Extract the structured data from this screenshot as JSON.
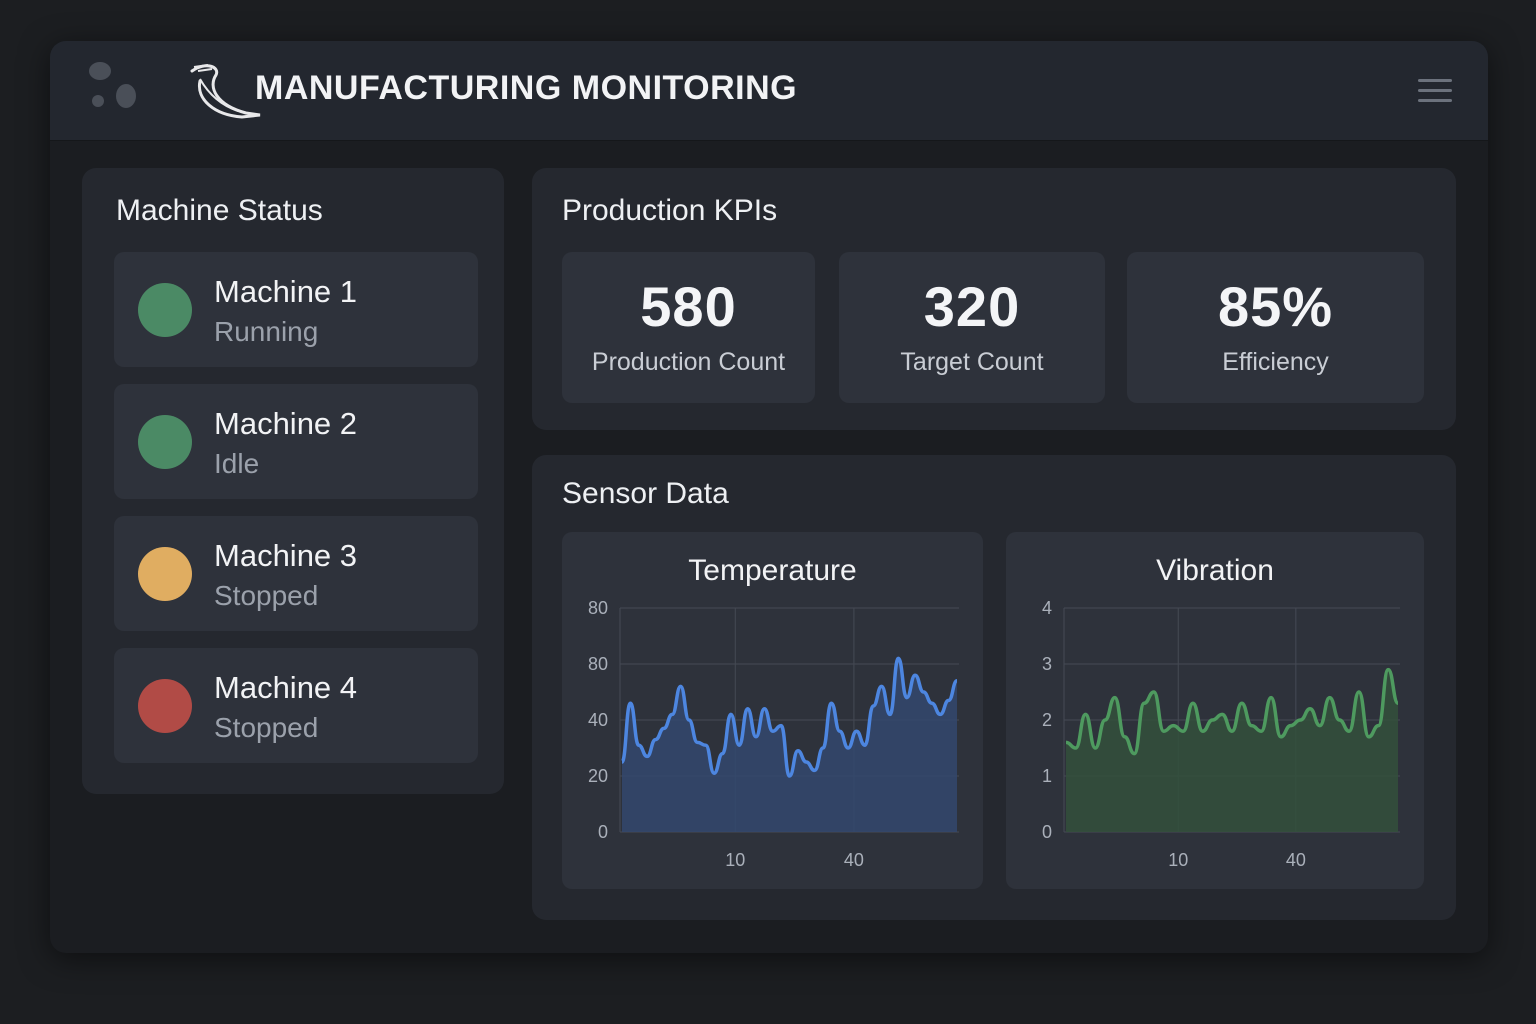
{
  "header": {
    "title": "MANUFACTURING MONITORING",
    "app_icon": "cluster-dots-icon",
    "brand_icon": "horn-logo-icon",
    "menu_icon": "hamburger-menu-icon"
  },
  "machine_status": {
    "title": "Machine Status",
    "machines": [
      {
        "name": "Machine 1",
        "state": "Running",
        "color": "#4b8a65"
      },
      {
        "name": "Machine 2",
        "state": "Idle",
        "color": "#4b8a65"
      },
      {
        "name": "Machine 3",
        "state": "Stopped",
        "color": "#e0ad61"
      },
      {
        "name": "Machine 4",
        "state": "Stopped",
        "color": "#b14b46"
      }
    ]
  },
  "kpis": {
    "title": "Production KPIs",
    "items": [
      {
        "value": "580",
        "label": "Production Count"
      },
      {
        "value": "320",
        "label": "Target Count"
      },
      {
        "value": "85%",
        "label": "Efficiency"
      }
    ]
  },
  "sensor": {
    "title": "Sensor Data",
    "charts": [
      {
        "title": "Temperature",
        "color": "#4d86e0",
        "fill": "#33486e",
        "y_ticks": [
          "0",
          "20",
          "40",
          "80",
          "80"
        ],
        "x_ticks": [
          "10",
          "40"
        ],
        "values": [
          25,
          46,
          31,
          27,
          33,
          37,
          42,
          52,
          40,
          32,
          31,
          21,
          28,
          42,
          31,
          44,
          34,
          44,
          36,
          38,
          20,
          29,
          25,
          22,
          30,
          46,
          36,
          30,
          36,
          31,
          45,
          52,
          42,
          62,
          48,
          56,
          50,
          46,
          42,
          47,
          54
        ]
      },
      {
        "title": "Vibration",
        "color": "#4e9a5f",
        "fill": "#33503c",
        "y_ticks": [
          "0",
          "1",
          "2",
          "3",
          "4"
        ],
        "x_ticks": [
          "10",
          "40"
        ],
        "values": [
          1.6,
          1.5,
          2.1,
          1.5,
          2.0,
          2.4,
          1.7,
          1.4,
          2.3,
          2.5,
          1.8,
          1.9,
          1.8,
          2.3,
          1.8,
          2.0,
          2.1,
          1.8,
          2.3,
          1.9,
          1.8,
          2.4,
          1.7,
          1.9,
          2.0,
          2.2,
          1.9,
          2.4,
          2.0,
          1.8,
          2.5,
          1.7,
          1.9,
          2.9,
          2.3
        ]
      }
    ]
  }
}
